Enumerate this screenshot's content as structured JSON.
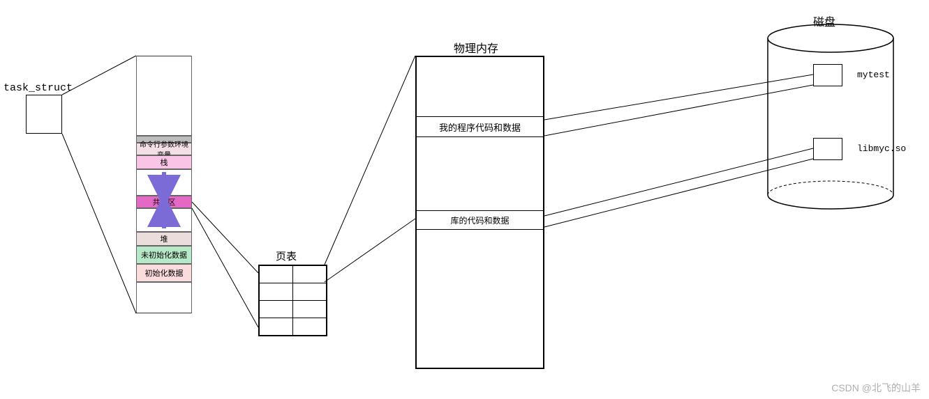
{
  "task_struct": {
    "label": "task_struct"
  },
  "addr_space": {
    "cmdline_env": "命令行参数环境变量",
    "stack": "栈",
    "shared": "共享区",
    "heap": "堆",
    "bss": "未初始化数据",
    "data": "初始化数据"
  },
  "page_table": {
    "title": "页表"
  },
  "phys_mem": {
    "title": "物理内存",
    "my_code": "我的程序代码和数据",
    "lib_code": "库的代码和数据"
  },
  "disk": {
    "title": "磁盘",
    "file1": "mytest",
    "file2": "libmyc.so"
  },
  "watermark": "CSDN @北飞的山羊"
}
